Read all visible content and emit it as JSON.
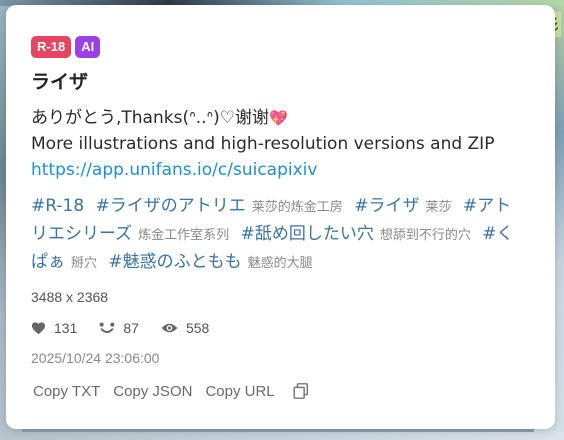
{
  "badges": {
    "r18": "R-18",
    "ai": "AI"
  },
  "title": "ライザ",
  "description": {
    "line1_text": "ありがとう,Thanks(ᐢ..ᐢ)♡谢谢",
    "line1_emoji": "💖",
    "line2": "More illustrations and high-resolution versions and ZIP",
    "link": "https://app.unifans.io/c/suicapixiv"
  },
  "tags": [
    {
      "name": "#R-18",
      "translation": ""
    },
    {
      "name": "#ライザのアトリエ",
      "translation": "莱莎的炼金工房"
    },
    {
      "name": "#ライザ",
      "translation": "莱莎"
    },
    {
      "name": "#アトリエシリーズ",
      "translation": "炼金工作室系列"
    },
    {
      "name": "#舐め回したい穴",
      "translation": "想舔到不行的穴"
    },
    {
      "name": "#くぱぁ",
      "translation": "掰穴"
    },
    {
      "name": "#魅惑のふともも",
      "translation": "魅惑的大腿"
    }
  ],
  "resolution": "3488 x 2368",
  "stats": {
    "likes": "131",
    "bookmarks": "87",
    "views": "558"
  },
  "date": "2025/10/24 23:06:00",
  "actions": {
    "copy_txt": "Copy TXT",
    "copy_json": "Copy JSON",
    "copy_url": "Copy URL"
  },
  "background": {
    "corner_text": "杉"
  },
  "colors": {
    "badge_r18": "#e74363",
    "badge_ai": "#9c3fe6",
    "link": "#1e8fd0",
    "tag": "#3a74a6"
  },
  "icons": {
    "likes": "heart-icon",
    "bookmarks": "bookmark-face-icon",
    "views": "eye-icon",
    "copy": "copy-icon"
  }
}
